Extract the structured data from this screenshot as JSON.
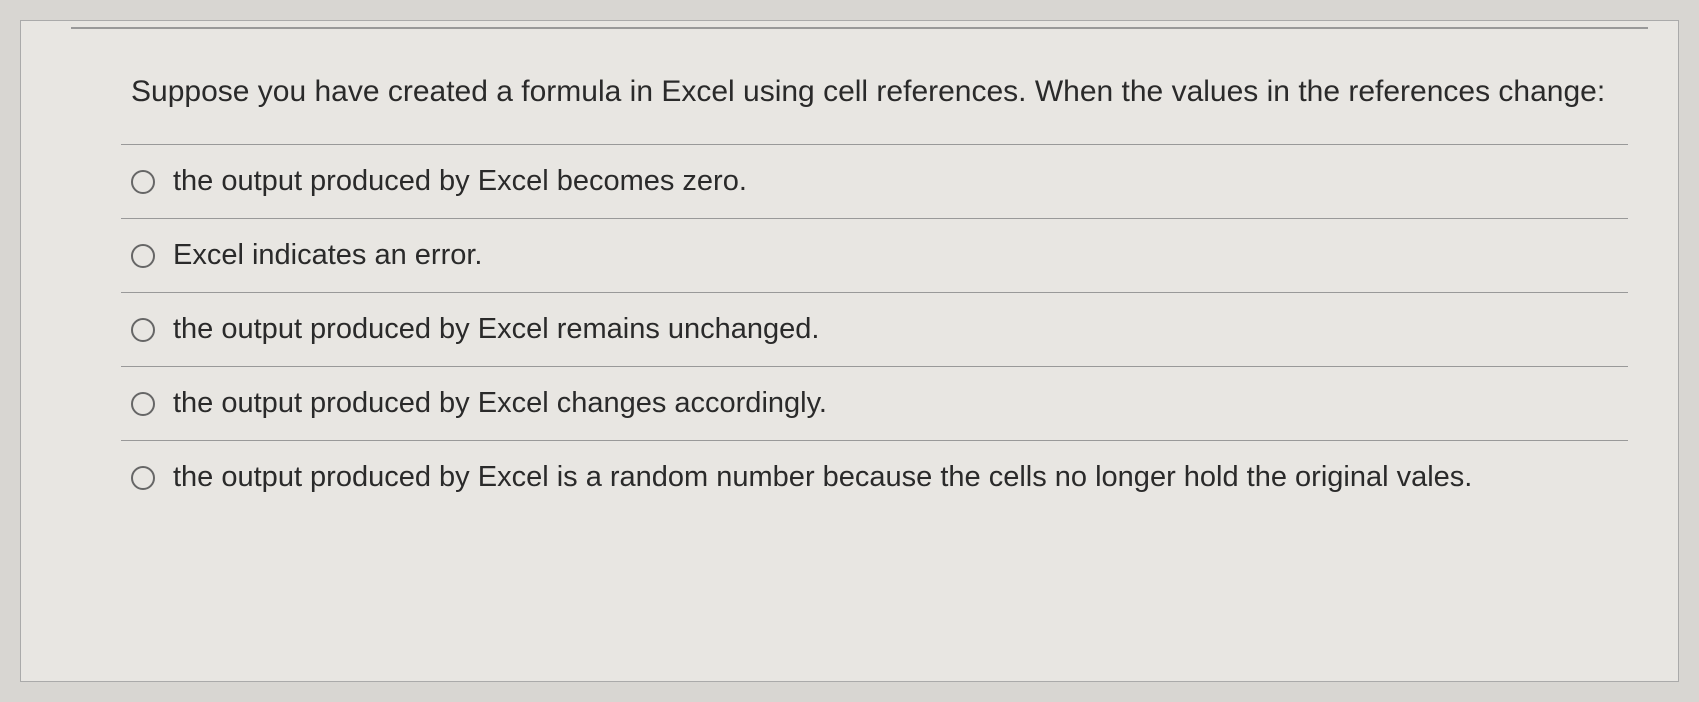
{
  "question": {
    "prompt": "Suppose you have created a formula in Excel using cell references. When the values in the references change:"
  },
  "options": [
    {
      "label": "the output produced by Excel becomes zero."
    },
    {
      "label": "Excel indicates an error."
    },
    {
      "label": "the output produced by Excel remains unchanged."
    },
    {
      "label": "the output produced by Excel changes accordingly."
    },
    {
      "label": "the output produced by Excel is a random number because the cells no longer hold the original vales."
    }
  ]
}
